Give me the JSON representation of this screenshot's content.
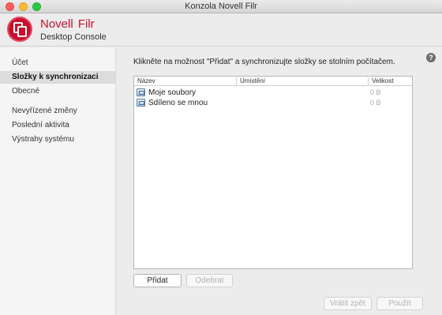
{
  "window": {
    "title": "Konzola Novell Filr"
  },
  "brand": {
    "name": "Novell",
    "mark": ".",
    "product": "Filr",
    "subtitle": "Desktop Console",
    "color": "#c8102e"
  },
  "sidebar": {
    "items": [
      {
        "label": "Účet",
        "active": false
      },
      {
        "label": "Složky k synchronizaci",
        "active": true
      },
      {
        "label": "Obecné",
        "active": false
      },
      {
        "label": "Nevyřízené změny",
        "active": false
      },
      {
        "label": "Poslední aktivita",
        "active": false
      },
      {
        "label": "Výstrahy systému",
        "active": false
      }
    ]
  },
  "main": {
    "help_label": "?",
    "instruction": "Klikněte na možnost \"Přidat\" a synchronizujte složky se stolním počítačem.",
    "table": {
      "headers": {
        "name": "Název",
        "location": "Umístění",
        "size": "Velikost"
      },
      "rows": [
        {
          "name": "Moje soubory",
          "size": "0 B"
        },
        {
          "name": "Sdíleno se mnou",
          "size": "0 B"
        }
      ]
    },
    "buttons": {
      "add": "Přidat",
      "remove": "Odebrat",
      "revert": "Vrátit zpět",
      "apply": "Použít"
    }
  }
}
